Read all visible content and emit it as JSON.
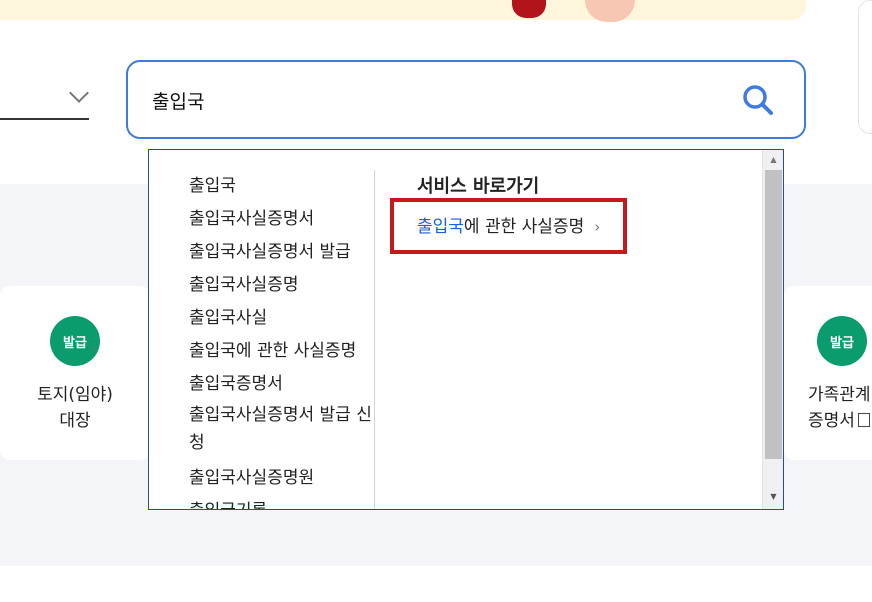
{
  "colors": {
    "search_border": "#3f7ae0",
    "badge_bg": "#0a9b6f",
    "highlight_red": "#c41a1a",
    "link_blue": "#1d5fd6",
    "dropdown_border": "#2b4c91"
  },
  "search": {
    "value": "출입국",
    "button_icon": "search-icon"
  },
  "cards": {
    "left": {
      "badge": "발급",
      "title_line1": "토지(임야)",
      "title_line2": "대장"
    },
    "right": {
      "badge": "발급",
      "title_line1": "가족관계",
      "title_line2": "증명서",
      "external_icon": "external-link-icon"
    }
  },
  "autocomplete": {
    "suggestions": [
      "출입국",
      "출입국사실증명서",
      "출입국사실증명서 발급",
      "출입국사실증명",
      "출입국사실",
      "출입국에 관한 사실증명",
      "출입국증명서",
      "출입국사실증명서 발급 신청",
      "출입국사실증명원",
      "출입국기록"
    ],
    "service_title": "서비스 바로가기",
    "service_link": {
      "highlight": "출입국",
      "rest": "에 관한 사실증명",
      "arrow": "›"
    },
    "scroll_up": "▲",
    "scroll_down": "▼"
  }
}
